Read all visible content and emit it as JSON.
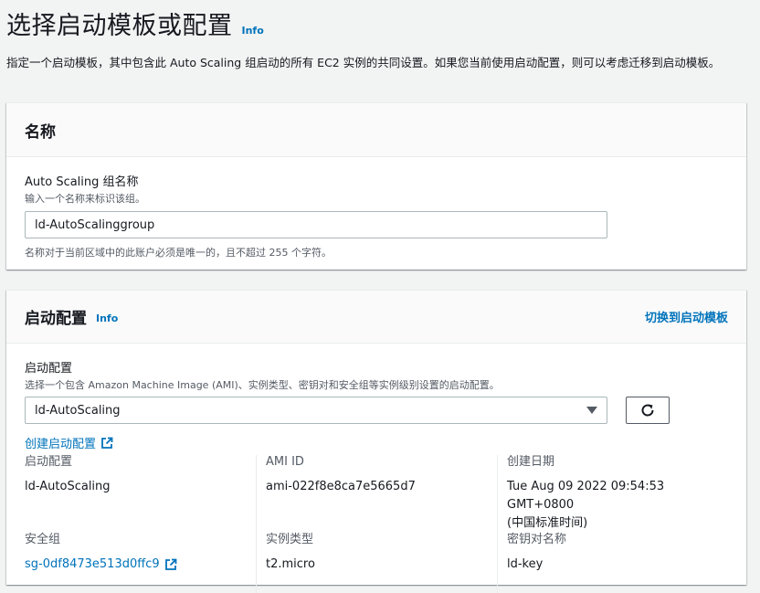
{
  "header": {
    "title": "选择启动模板或配置",
    "info": "Info",
    "description": "指定一个启动模板，其中包含此 Auto Scaling 组启动的所有 EC2 实例的共同设置。如果您当前使用启动配置，则可以考虑迁移到启动模板。"
  },
  "name_panel": {
    "title": "名称",
    "field_label": "Auto Scaling 组名称",
    "field_desc": "输入一个名称来标识该组。",
    "field_value": "ld-AutoScalinggroup",
    "constraint": "名称对于当前区域中的此账户必须是唯一的，且不超过 255 个字符。"
  },
  "launch_panel": {
    "title": "启动配置",
    "info": "Info",
    "switch_link": "切换到启动模板",
    "field_label": "启动配置",
    "field_desc": "选择一个包含 Amazon Machine Image (AMI)、实例类型、密钥对和安全组等实例级别设置的启动配置。",
    "selected": "ld-AutoScaling",
    "create_link": "创建启动配置",
    "details": {
      "launch_config_label": "启动配置",
      "launch_config_value": "ld-AutoScaling",
      "ami_label": "AMI ID",
      "ami_value": "ami-022f8e8ca7e5665d7",
      "created_label": "创建日期",
      "created_value_line1": "Tue Aug 09 2022 09:54:53 GMT+0800",
      "created_value_line2": "(中国标准时间)",
      "sg_label": "安全组",
      "sg_value": "sg-0df8473e513d0ffc9",
      "instance_type_label": "实例类型",
      "instance_type_value": "t2.micro",
      "key_label": "密钥对名称",
      "key_value": "ld-key"
    }
  },
  "colors": {
    "link": "#0073bb",
    "text": "#16191f",
    "secondary": "#545b64",
    "background": "#f2f3f3"
  },
  "icons": [
    "external-link-icon",
    "refresh-icon",
    "caret-down-icon"
  ]
}
